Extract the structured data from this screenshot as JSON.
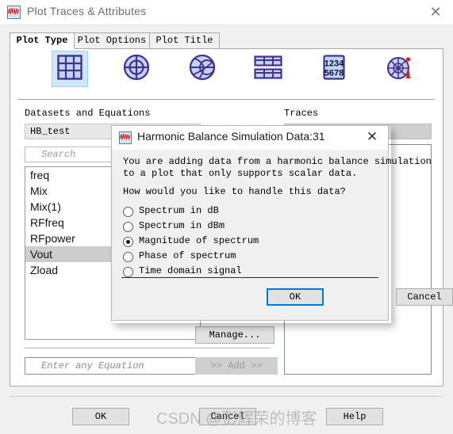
{
  "window": {
    "title": "Plot Traces & Attributes",
    "icon": "plot-window-icon",
    "close_label": "✕"
  },
  "tabs": [
    {
      "label": "Plot Type",
      "selected": true
    },
    {
      "label": "Plot Options",
      "selected": false
    },
    {
      "label": "Plot Title",
      "selected": false
    }
  ],
  "plot_types": [
    {
      "name": "rectangular-plot-icon",
      "selected": true
    },
    {
      "name": "polar-plot-icon",
      "selected": false
    },
    {
      "name": "smith-chart-icon",
      "selected": false
    },
    {
      "name": "stacked-table-icon",
      "selected": false
    },
    {
      "name": "list-numbers-icon",
      "selected": false,
      "digits_top": "1234",
      "digits_bottom": "5678"
    },
    {
      "name": "antenna-pattern-icon",
      "selected": false
    }
  ],
  "datasets": {
    "section_label": "Datasets and Equations",
    "selected_dataset": "HB_test",
    "search_placeholder": "Search",
    "items": [
      {
        "label": "freq",
        "selected": false
      },
      {
        "label": "Mix",
        "selected": false
      },
      {
        "label": "Mix(1)",
        "selected": false
      },
      {
        "label": "RFfreq",
        "selected": false
      },
      {
        "label": "RFpower",
        "selected": false
      },
      {
        "label": "Vout",
        "selected": true
      },
      {
        "label": "Zload",
        "selected": false
      }
    ],
    "equation_placeholder": "Enter any Equation"
  },
  "traces": {
    "section_label": "Traces",
    "header_value": "",
    "items": []
  },
  "buttons": {
    "manage": "Manage...",
    "add": ">> Add >>",
    "ok": "OK",
    "cancel": "Cancel",
    "help": "Help"
  },
  "dialog": {
    "icon": "plot-window-icon",
    "title": "Harmonic Balance Simulation Data:31",
    "close_label": "✕",
    "paragraph_line1": "You are adding data from a harmonic balance simulation",
    "paragraph_line2": "to a plot that only supports scalar data.",
    "question": "How would you like to handle this data?",
    "options": [
      {
        "label": "Spectrum in dB",
        "selected": false
      },
      {
        "label": "Spectrum in dBm",
        "selected": false
      },
      {
        "label": "Magnitude of spectrum",
        "selected": true
      },
      {
        "label": "Phase of spectrum",
        "selected": false
      },
      {
        "label": "Time domain signal",
        "selected": false
      }
    ],
    "ok": "OK",
    "cancel": "Cancel"
  },
  "watermark": {
    "text": "CSDN @彭辉荣的博客"
  },
  "colors": {
    "accent": "#0078d7",
    "icon_purple": "#5b3fa0",
    "icon_fill": "#bcd6f5",
    "selection": "#cdcdcd",
    "type_selected_bg": "#cce8ff"
  }
}
